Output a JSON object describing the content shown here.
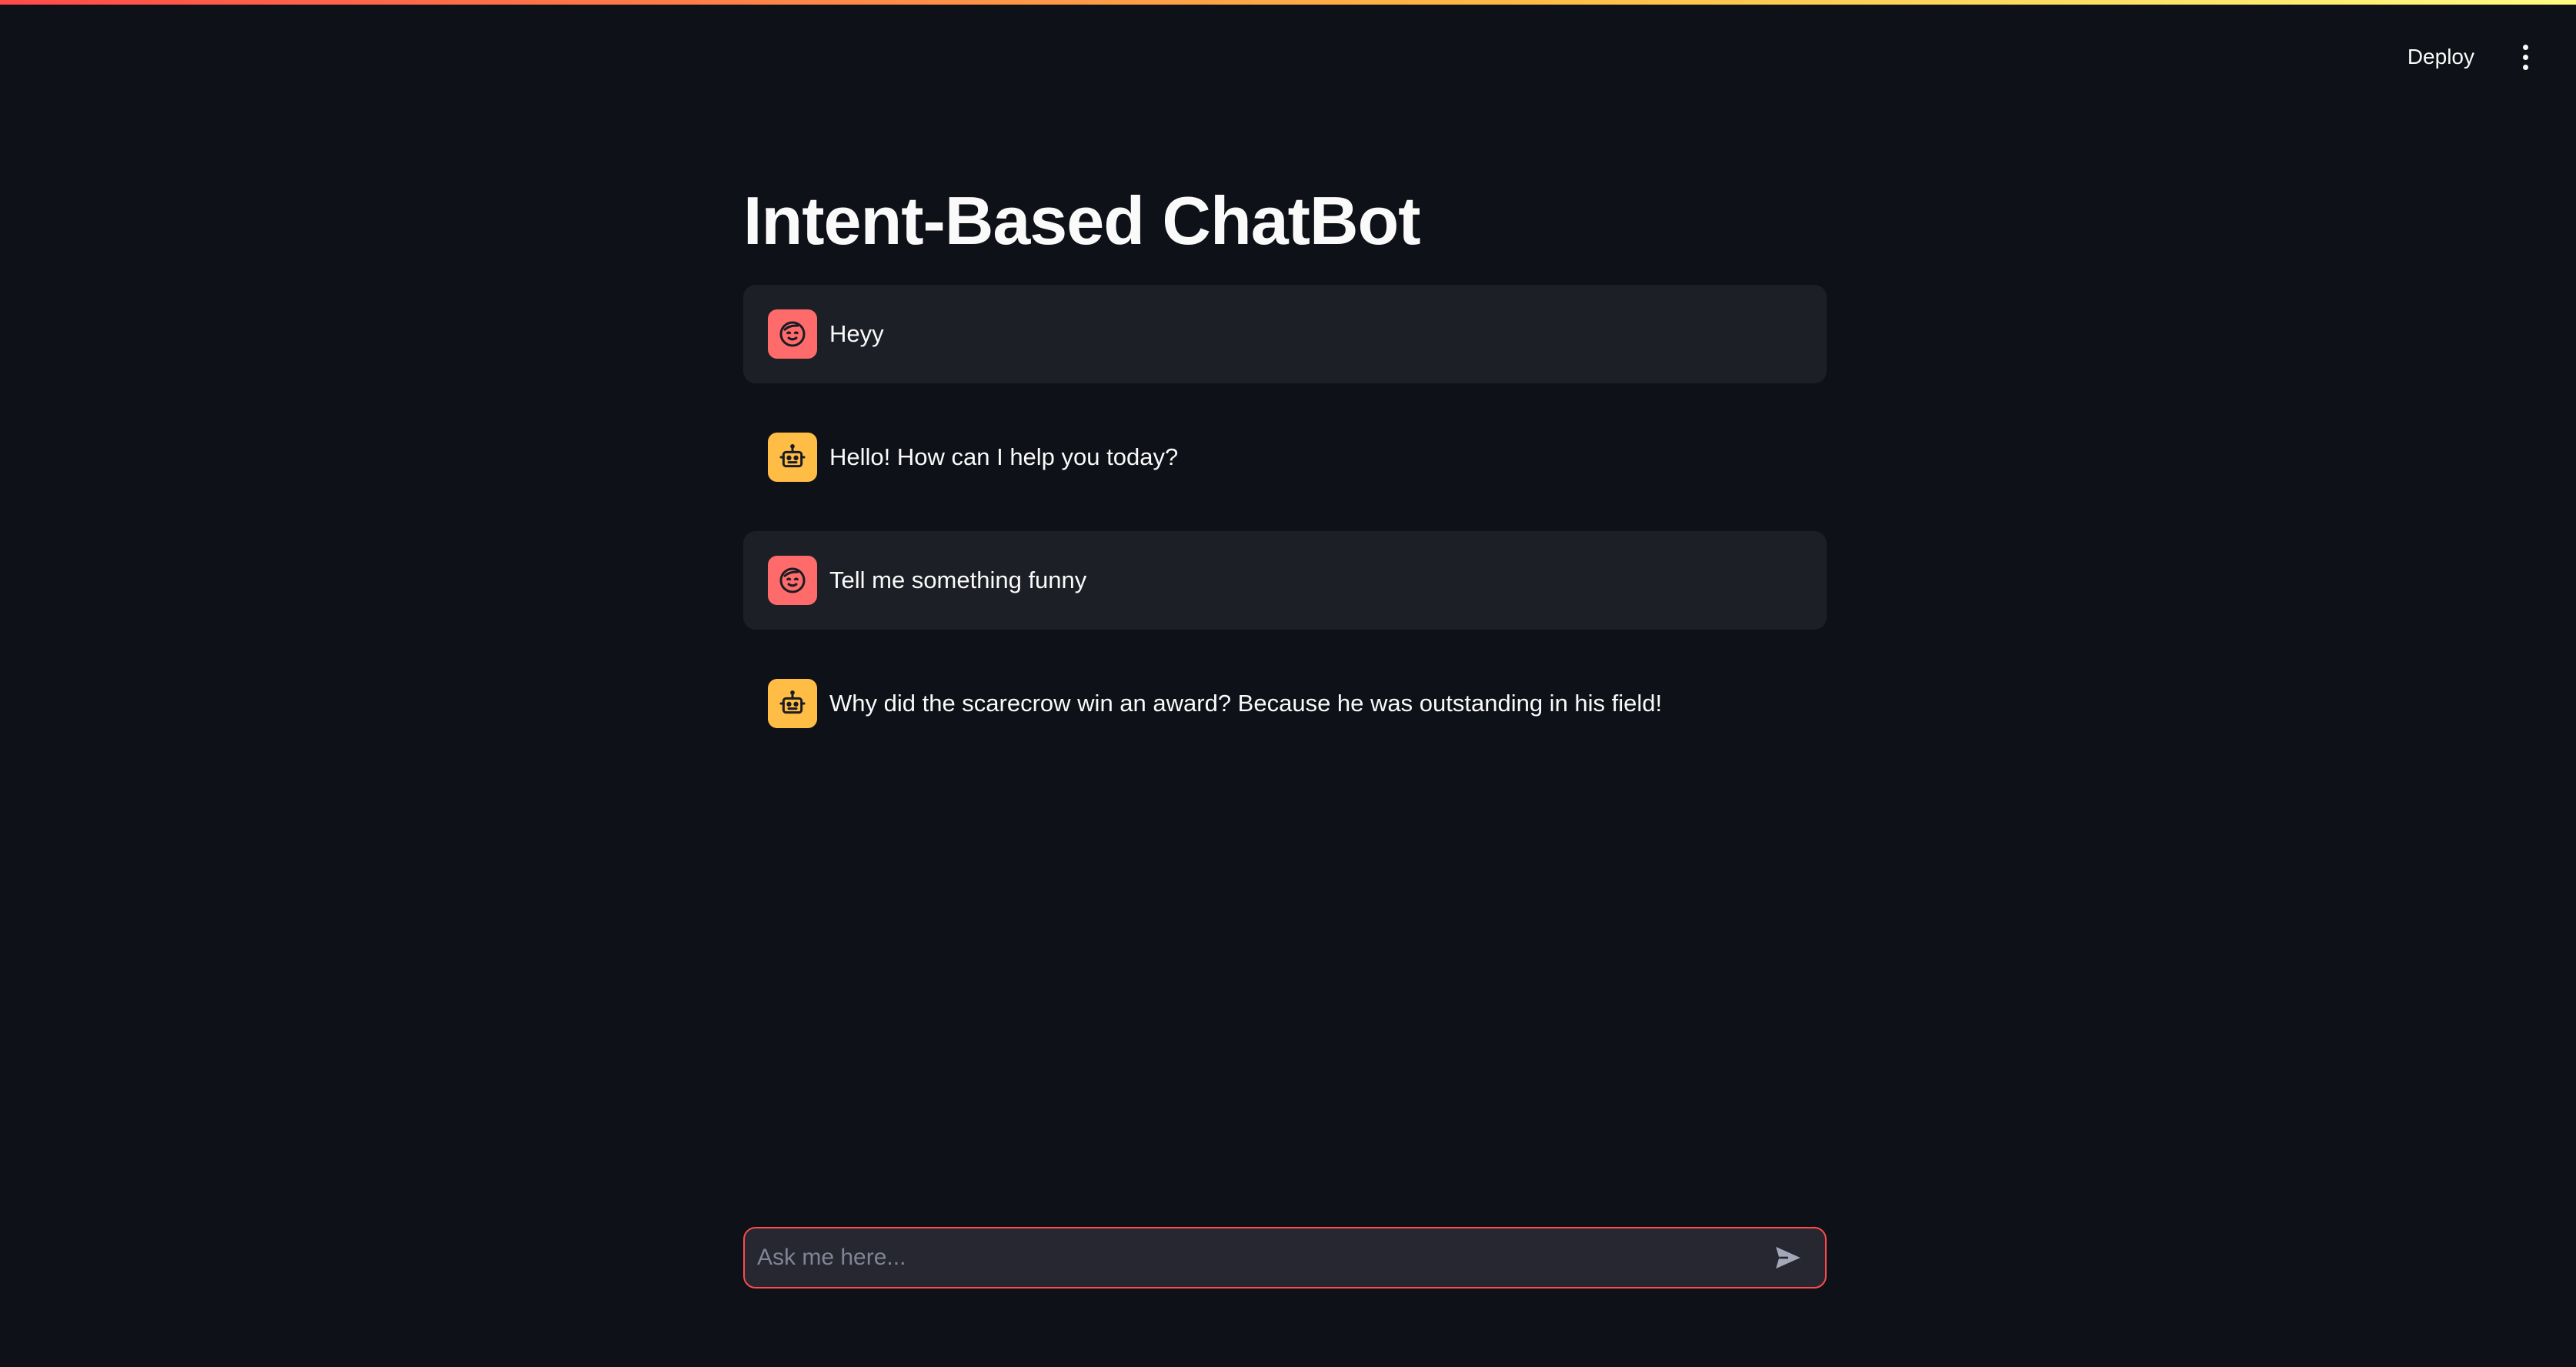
{
  "header": {
    "deploy_label": "Deploy",
    "menu_icon": "more-vertical-icon"
  },
  "page": {
    "title": "Intent-Based ChatBot"
  },
  "messages": [
    {
      "role": "user",
      "avatar_icon": "user-face-icon",
      "text": "Heyy"
    },
    {
      "role": "assistant",
      "avatar_icon": "robot-icon",
      "text": "Hello! How can I help you today?"
    },
    {
      "role": "user",
      "avatar_icon": "user-face-icon",
      "text": "Tell me something funny"
    },
    {
      "role": "assistant",
      "avatar_icon": "robot-icon",
      "text": "Why did the scarecrow win an award? Because he was outstanding in his field!"
    }
  ],
  "chat_input": {
    "placeholder": "Ask me here...",
    "value": "",
    "send_icon": "send-icon"
  },
  "colors": {
    "background": "#0e1117",
    "user_avatar": "#ff6b6b",
    "assistant_avatar": "#ffbd45",
    "user_message_bg": "#1d1f27",
    "input_border_focus": "#ff4b4b",
    "input_bg": "#262730"
  }
}
